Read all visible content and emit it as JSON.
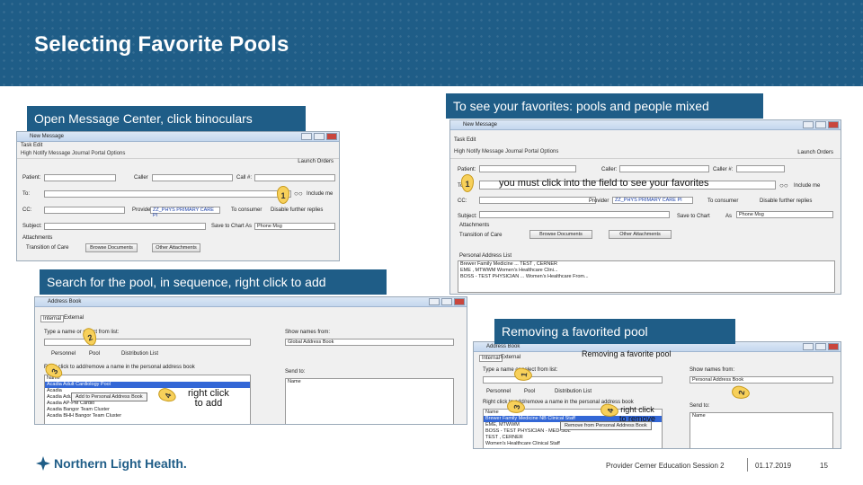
{
  "slide": {
    "title": "Selecting Favorite Pools"
  },
  "captions": {
    "c1": "Open Message Center, click binoculars",
    "c2": "To see your favorites: pools and people mixed",
    "c3": "Search for the pool, in sequence, right click to add",
    "c4": "Removing a favorited pool"
  },
  "shot1": {
    "window_title": "New Message",
    "menu": "Task   Edit",
    "toolbar": "High   Notify   Message Journal   Portal Options",
    "labels": {
      "patient": "Patient:",
      "caller": "Caller",
      "callback": "Call #:",
      "to": "To:",
      "cc": "CC:",
      "subject": "Subject:",
      "attachments": "Attachments",
      "include_me": "Include me",
      "provider": "Provider",
      "provider_value": "ZZ_PHYS PRIMARY CARE PI",
      "to_consumer": "To consumer",
      "disable": "Disable further replies",
      "save_chart": "Save to Chart",
      "as": "As",
      "as_value": "Phone Msg",
      "transition": "Transition of Care",
      "launch": "Launch Orders"
    },
    "buttons": {
      "browse": "Browse Documents",
      "other": "Other Attachments"
    },
    "badge": "1"
  },
  "shot2": {
    "window_title": "New Message",
    "menu": "Task   Edit",
    "toolbar": "High   Notify   Message Journal   Portal Options",
    "launch": "Launch Orders",
    "labels": {
      "patient": "Patient:",
      "caller": "Caller:",
      "callback": "Caller #:",
      "to": "To:",
      "cc": "CC:",
      "subject": "Subject:",
      "attachments": "Attachments",
      "include_me": "Include me",
      "provider": "Provider",
      "provider_value": "ZZ_PHYS PRIMARY CARE PI",
      "to_consumer": "To consumer",
      "disable": "Disable further replies",
      "save_chart": "Save to Chart",
      "as": "As",
      "as_value": "Phone Msg",
      "transition": "Transition of Care",
      "pal": "Personal Address List"
    },
    "buttons": {
      "browse": "Browse Documents",
      "other": "Other Attachments"
    },
    "hint": "you must click into the field to see your favorites",
    "badge": "1",
    "pal_rows": [
      "Brewer Family Medicine ...   TEST , CERNER",
      "EME , MTWWM           Women's Healthcare Clini...",
      "BOSS - TEST PHYSICIAN ...   Women's Healthcare From..."
    ]
  },
  "shot3": {
    "window_title": "Address Book",
    "tabs": [
      "Internal",
      "External"
    ],
    "type_label": "Type a name or select from list:",
    "radios": [
      "Personnel",
      "Pool",
      "Distribution List"
    ],
    "hint_label": "Right click to add/remove a name in the personal address book",
    "show_label": "Show names from:",
    "show_value": "Global Address Book",
    "send_to": "Send to:",
    "send_name": "Name",
    "list_rows": [
      "Name",
      "Acadia Adult Cardiology Pool",
      "Acadia",
      "Acadia Adult ST Pulmonary",
      "Acadia AP-PM Cardio",
      "Acadia Bangor Team Cluster",
      "Acadia BHH Bangor Team Cluster"
    ],
    "context_menu": "Add to Personal Address Book",
    "badges": [
      "2",
      "3",
      "4"
    ],
    "handwrite": "right click\nto add"
  },
  "shot4": {
    "window_title": "Address Book",
    "tabs": [
      "Internal",
      "External"
    ],
    "heading": "Removing a favorite pool",
    "type_label": "Type a name or select from list:",
    "radios": [
      "Personnel",
      "Pool",
      "Distribution List"
    ],
    "hint_label": "Right click to add/remove a name in the personal address book",
    "show_label": "Show names from:",
    "show_value": "Personal Address Book",
    "send_to": "Send to:",
    "send_name": "Name",
    "list_rows": [
      "Name",
      "Brewer Family Medicine NB Clinical Staff",
      "EME, MTWWM",
      "BOSS - TEST PHYSICIAN - MED-SUL",
      "TEST , CERNER",
      "Women's Healthcare Clinical Staff"
    ],
    "context_menu": "Remove from Personal Address Book",
    "badges": [
      "1",
      "2",
      "3",
      "4"
    ],
    "handwrite": "right click\nto remove"
  },
  "footer": {
    "logo_text": "Northern Light Health.",
    "session": "Provider Cerner Education Session 2",
    "date": "01.17.2019",
    "page": "15"
  }
}
